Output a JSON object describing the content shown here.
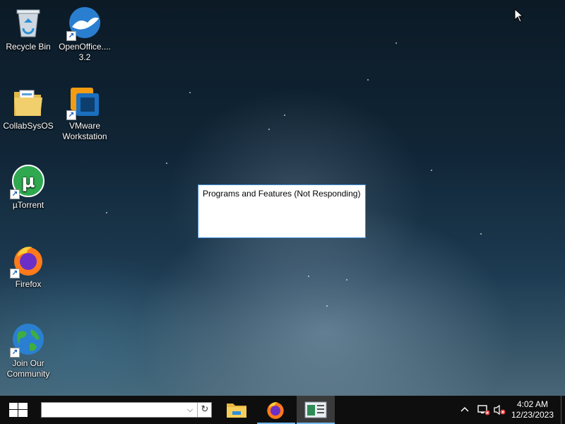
{
  "desktop": {
    "icons": [
      {
        "label": "Recycle Bin",
        "icon": "recycle-bin-icon"
      },
      {
        "label": "OpenOffice.... 3.2",
        "icon": "openoffice-icon"
      },
      {
        "label": "CollabSysOS",
        "icon": "folder-icon"
      },
      {
        "label": "VMware Workstation",
        "icon": "vmware-icon"
      },
      {
        "label": "µTorrent",
        "icon": "utorrent-icon"
      },
      {
        "label": "Firefox",
        "icon": "firefox-icon"
      },
      {
        "label": "Join Our Community",
        "icon": "globe-icon"
      }
    ]
  },
  "dialog": {
    "title": "Programs and Features (Not Responding)"
  },
  "taskbar": {
    "address_value": "",
    "apps": [
      {
        "name": "File Explorer",
        "icon": "file-explorer-icon"
      },
      {
        "name": "Firefox",
        "icon": "firefox-icon"
      },
      {
        "name": "Programs and Features",
        "icon": "programs-features-icon",
        "active": true
      }
    ],
    "clock": {
      "time": "4:02 AM",
      "date": "12/23/2023"
    }
  },
  "colors": {
    "taskbar": "#0e0e0e",
    "dialog_border": "#3c8dd8",
    "active_underline": "#76b9ed"
  }
}
